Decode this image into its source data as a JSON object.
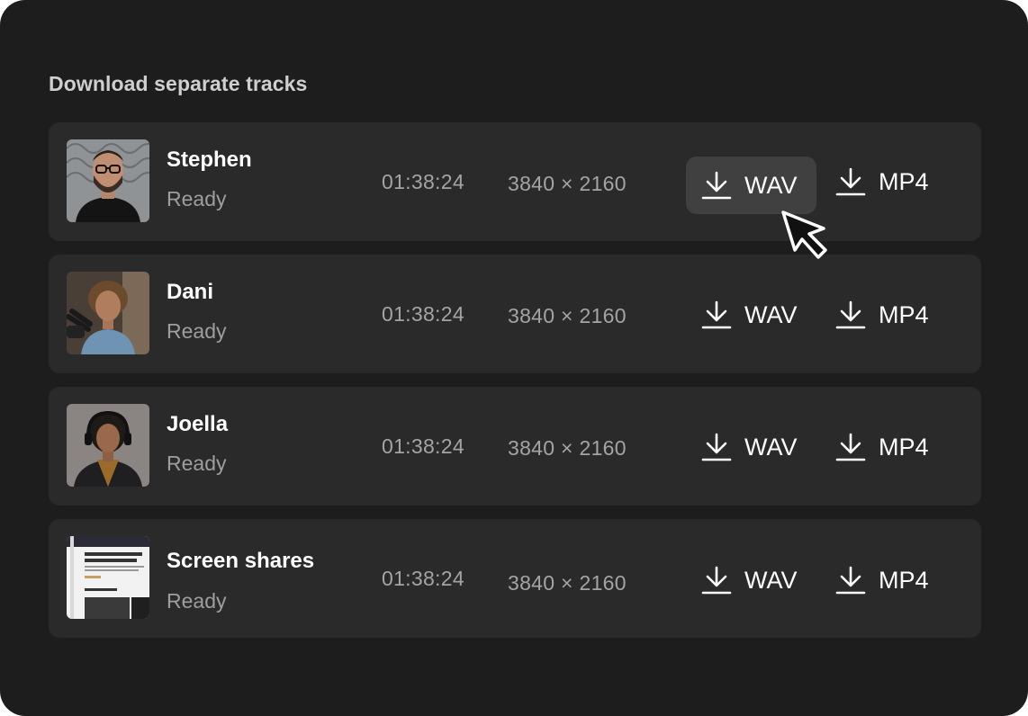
{
  "heading": "Download separate tracks",
  "tracks": [
    {
      "name": "Stephen",
      "status": "Ready",
      "duration": "01:38:24",
      "resolution": "3840 × 2160",
      "wav_label": "WAV",
      "mp4_label": "MP4",
      "thumb": "stephen-photo"
    },
    {
      "name": "Dani",
      "status": "Ready",
      "duration": "01:38:24",
      "resolution": "3840 × 2160",
      "wav_label": "WAV",
      "mp4_label": "MP4",
      "thumb": "dani-photo"
    },
    {
      "name": "Joella",
      "status": "Ready",
      "duration": "01:38:24",
      "resolution": "3840 × 2160",
      "wav_label": "WAV",
      "mp4_label": "MP4",
      "thumb": "joella-photo"
    },
    {
      "name": "Screen shares",
      "status": "Ready",
      "duration": "01:38:24",
      "resolution": "3840 × 2160",
      "wav_label": "WAV",
      "mp4_label": "MP4",
      "thumb": "screen-share-thumbnail"
    }
  ],
  "icons": {
    "download": "download-icon",
    "cursor": "mouse-pointer-icon"
  },
  "colors": {
    "background": "#1d1d1e",
    "row": "#2a2a2b",
    "hover": "#404041",
    "text": "#ffffff",
    "muted": "#a4a4a4"
  }
}
